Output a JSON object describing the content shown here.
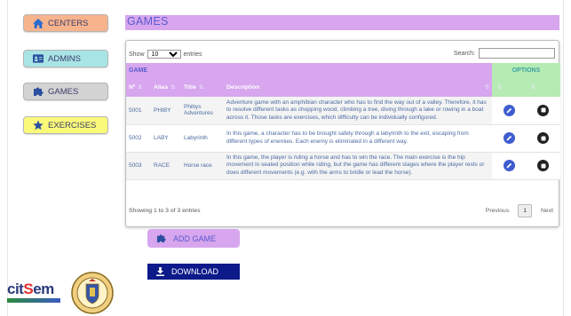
{
  "nav": {
    "centers": "CENTERS",
    "admins": "ADMINS",
    "games": "GAMES",
    "exercises": "EXERCISES"
  },
  "page": {
    "title": "GAMES"
  },
  "table_controls": {
    "show_label": "Show",
    "entries_value": "10",
    "entries_label": "entries",
    "search_label": "Search:"
  },
  "table": {
    "group_header": "GAME",
    "options_header": "OPTIONS",
    "columns": [
      "Nº",
      "Alias",
      "Title",
      "Description"
    ],
    "rows": [
      {
        "num": "5001",
        "alias": "PHIBY",
        "title": "Phibys Adventures",
        "description": "Adventure game with an amphibian character who has to find the way out of a valley. Therefore, it has to resolve different tasks as chopping wood, climbing a tree, diving through a lake or rowing in a boat across it. Those tasks are exercises, which difficulty can be individually configured."
      },
      {
        "num": "5002",
        "alias": "LABY",
        "title": "Labyrinth",
        "description": "In this game, a character has to be brought safely through a labyrinth to the exit, escaping from different types of enemies. Each enemy is eliminated in a different way."
      },
      {
        "num": "5003",
        "alias": "RACE",
        "title": "Horse race",
        "description": "In this game, the player is riding a horse and has to win the race. The main exercise is the hip movement in seated position while riding, but the game has different stages where the player rests or does different movements (e.g. with the arms to bridle or lead the horse)."
      }
    ],
    "info": "Showing 1 to 3 of 3 entries",
    "pager": {
      "previous": "Previous",
      "current": "1",
      "next": "Next"
    }
  },
  "actions": {
    "add_game": "ADD GAME",
    "download": "DOWNLOAD"
  },
  "logo": {
    "text_a": "cit",
    "text_b": "S",
    "text_c": "em"
  },
  "colors": {
    "title_bg": "#d7a6ee",
    "options_bg": "#b6ecb4",
    "edit_icon": "#3e5dcf",
    "download_bg": "#0d1a8a"
  },
  "icons": {
    "centers": "home-icon",
    "admins": "id-card-icon",
    "games": "puzzle-icon",
    "exercises": "star-icon",
    "edit": "pencil-icon",
    "delete": "stop-icon",
    "add": "puzzle-icon",
    "download": "download-icon"
  }
}
